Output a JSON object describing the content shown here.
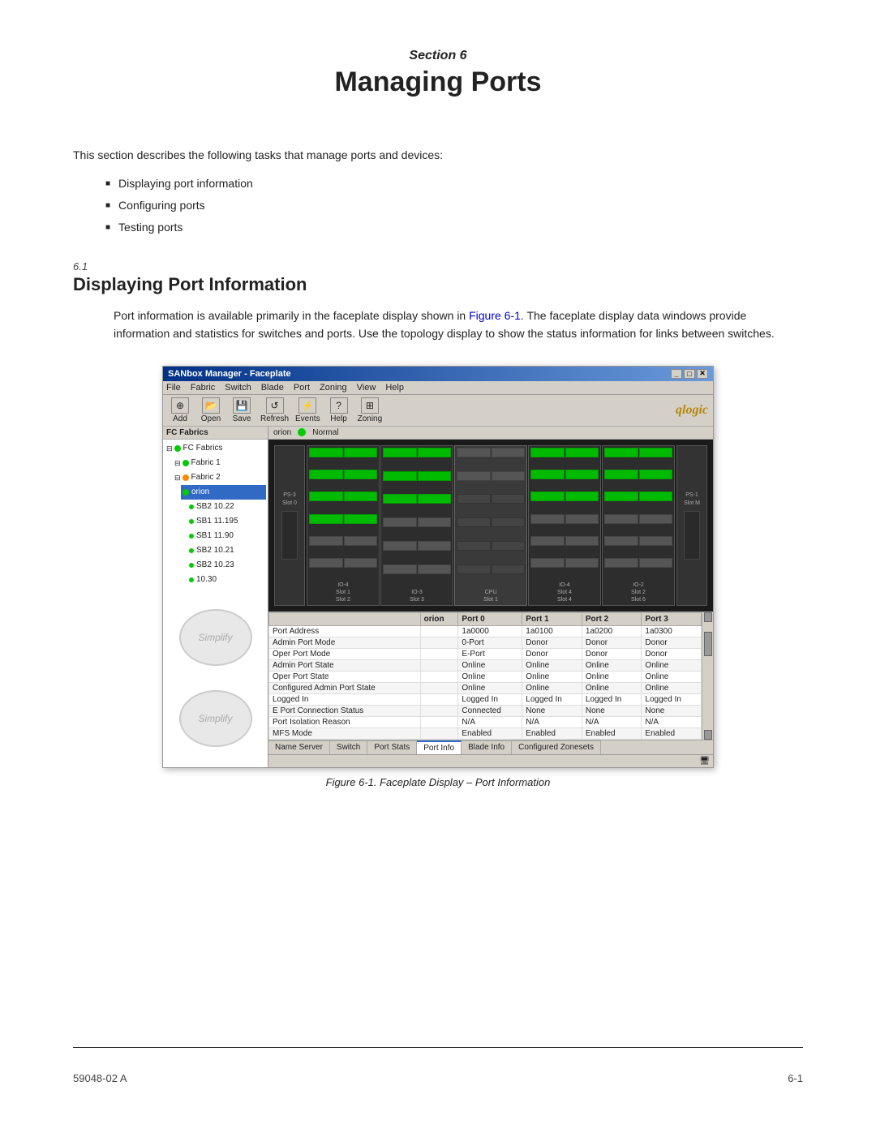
{
  "header": {
    "section_label": "Section",
    "section_number": "6",
    "title": "Managing Ports"
  },
  "intro": {
    "text": "This section describes the following tasks that manage ports and devices:",
    "bullets": [
      "Displaying port information",
      "Configuring ports",
      "Testing ports"
    ]
  },
  "subsection": {
    "number": "6.1",
    "title": "Displaying Port Information",
    "body1": "Port information is available primarily in the faceplate display shown in Figure 6-1. The faceplate display data windows provide information and statistics for switches and ports. Use the topology display to show the status information for links between switches."
  },
  "figure": {
    "window_title": "SANbox Manager - Faceplate",
    "menu_items": [
      "File",
      "Fabric",
      "Switch",
      "Blade",
      "Port",
      "Zoning",
      "View",
      "Help"
    ],
    "toolbar_buttons": [
      "Add",
      "Open",
      "Save",
      "Refresh",
      "Events",
      "Help",
      "Zoning"
    ],
    "logo": "qlogic",
    "left_panel_header": "FC Fabrics",
    "switch_name": "orion",
    "status_text": "Normal",
    "tree_items": [
      {
        "label": "Fabric 1",
        "indent": 1,
        "type": "fabric"
      },
      {
        "label": "Fabric 2",
        "indent": 1,
        "type": "fabric"
      },
      {
        "label": "orion",
        "indent": 2,
        "type": "switch-selected"
      },
      {
        "label": "SB2 10.22",
        "indent": 3,
        "type": "switch"
      },
      {
        "label": "SB1 11.195",
        "indent": 3,
        "type": "switch"
      },
      {
        "label": "SB1 11.90",
        "indent": 3,
        "type": "switch"
      },
      {
        "label": "SB2 10.21",
        "indent": 3,
        "type": "switch"
      },
      {
        "label": "SB2 10.23",
        "indent": 3,
        "type": "switch"
      },
      {
        "label": "10.30",
        "indent": 3,
        "type": "switch"
      }
    ],
    "table": {
      "columns": [
        "",
        "orion",
        "Port 0",
        "Port 1",
        "Port 2",
        "Port 3"
      ],
      "rows": [
        [
          "Port Address",
          "",
          "1a0000",
          "1a0100",
          "1a0200",
          "1a0300"
        ],
        [
          "Admin Port Mode",
          "",
          "0-Port",
          "Donor",
          "Donor",
          "Donor"
        ],
        [
          "Oper Port Mode",
          "",
          "E-Port",
          "Donor",
          "Donor",
          "Donor"
        ],
        [
          "Admin Port State",
          "",
          "Online",
          "Online",
          "Online",
          "Online"
        ],
        [
          "Oper Port State",
          "",
          "Online",
          "Online",
          "Online",
          "Online"
        ],
        [
          "Configured Admin Port State",
          "",
          "Online",
          "Online",
          "Online",
          "Online"
        ],
        [
          "Logged In",
          "",
          "Logged In",
          "Logged In",
          "Logged In",
          "Logged In"
        ],
        [
          "E Port Connection Status",
          "",
          "Connected",
          "None",
          "None",
          "None"
        ],
        [
          "Port Isolation Reason",
          "",
          "N/A",
          "N/A",
          "N/A",
          "N/A"
        ],
        [
          "MFS Mode",
          "",
          "Enabled",
          "Enabled",
          "Enabled",
          "Enabled"
        ]
      ]
    },
    "tabs": [
      "Name Server",
      "Switch",
      "Port Stats",
      "Port Info",
      "Blade Info",
      "Configured Zonesets"
    ],
    "active_tab": "Port Info",
    "caption": "Figure 6-1.  Faceplate Display – Port Information"
  },
  "footer": {
    "left": "59048-02 A",
    "right": "6-1"
  }
}
